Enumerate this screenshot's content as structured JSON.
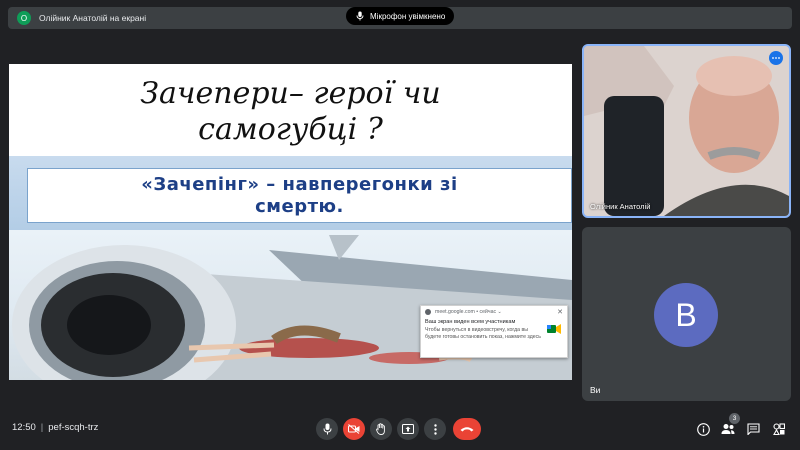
{
  "presenter": {
    "avatar_letter": "О",
    "text": "Олійник Анатолій на екрані"
  },
  "mic_status": "Мікрофон увімкнено",
  "slide": {
    "title_line1": "Зачепери– герої чи",
    "title_line2": "самогубці ?",
    "subtitle_line1": "«Зачепінг» – навперегонки зі",
    "subtitle_line2": "смертю."
  },
  "notification": {
    "source": "meet.google.com • сейчас ⌄",
    "title": "Ваш экран виден всем участникам",
    "message": "Чтобы вернуться в видеовстречу, когда вы будете готовы остановить показ, нажмите здесь",
    "close": "✕"
  },
  "participants": {
    "video_name": "Олійник Анатолій",
    "self_letter": "В",
    "self_name": "Ви",
    "count": "3"
  },
  "meeting": {
    "time": "12:50",
    "separator": "|",
    "code": "pef-scqh-trz"
  },
  "colors": {
    "background": "#202124",
    "accent": "#1a73e8",
    "end_call": "#ea4335",
    "self_avatar": "#5c6bc0"
  },
  "icons": [
    "mic-icon",
    "camera-off-icon",
    "hand-icon",
    "present-icon",
    "more-vert-icon",
    "end-call-icon",
    "info-icon",
    "people-icon",
    "chat-icon",
    "activities-icon"
  ]
}
